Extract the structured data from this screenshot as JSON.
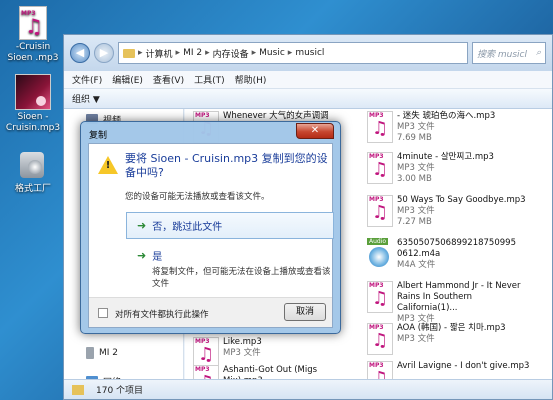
{
  "desktop": {
    "icons": [
      {
        "label": "-Cruisin Sioen .mp3",
        "icon": "mp3-file-icon",
        "badge": "MP3"
      },
      {
        "label": "Sioen - Cruisin.mp3",
        "icon": "album-art-icon"
      },
      {
        "label": "格式工厂",
        "icon": "format-factory-icon"
      }
    ]
  },
  "explorer": {
    "breadcrumb": [
      "计算机",
      "MI 2",
      "内存设备",
      "Music",
      "musicl"
    ],
    "search_placeholder": "搜索 musicl",
    "menu": [
      "文件(F)",
      "编辑(E)",
      "查看(V)",
      "工具(T)",
      "帮助(H)"
    ],
    "organize": "组织 ▼",
    "nav_items": [
      {
        "label": "视频",
        "icon": "video-folder-icon"
      },
      {
        "label": "MI 2",
        "icon": "phone-icon"
      },
      {
        "label": "网络",
        "icon": "network-icon"
      }
    ],
    "left_files": [
      {
        "name": "Whenever 大气的女声调调",
        "type": "",
        "size": ""
      },
      {
        "name": "Like.mp3",
        "type": "MP3 文件",
        "size": ""
      },
      {
        "name": "Ashanti-Got Out (Migs Mix).mp3",
        "type": "",
        "size": ""
      }
    ],
    "right_files": [
      {
        "name": "- 迷失 琥珀色の海へ.mp3",
        "type": "MP3 文件",
        "size": "7.69 MB",
        "kind": "mp3"
      },
      {
        "name": "4minute - 살만찌고.mp3",
        "type": "MP3 文件",
        "size": "3.00 MB",
        "kind": "mp3"
      },
      {
        "name": "50 Ways To Say Goodbye.mp3",
        "type": "MP3 文件",
        "size": "7.27 MB",
        "kind": "mp3"
      },
      {
        "name": "6350507506899218750995 0612.m4a",
        "type": "M4A 文件",
        "size": "",
        "kind": "m4a",
        "badge": "Audio"
      },
      {
        "name": "Albert Hammond Jr - It Never Rains In Southern California(1)...",
        "type": "MP3 文件",
        "size": "",
        "kind": "mp3"
      },
      {
        "name": "AOA (韩国) - 짧은 치마.mp3",
        "type": "MP3 文件",
        "size": "",
        "kind": "mp3"
      },
      {
        "name": "Avril Lavigne - I don't give.mp3",
        "type": "",
        "size": "",
        "kind": "mp3"
      }
    ],
    "status": "170 个项目"
  },
  "dialog": {
    "title": "复制",
    "close": "✕",
    "heading": "要将 Sioen - Cruisin.mp3 复制到您的设备中吗?",
    "sub": "您的设备可能无法播放或查看该文件。",
    "option1": "否，跳过此文件",
    "option2_title": "是",
    "option2_desc": "将复制文件，但可能无法在设备上播放或查看该文件",
    "checkbox_label": "对所有文件都执行此操作",
    "cancel": "取消",
    "option_arrow": "➜"
  },
  "colors": {
    "dialog_frame": "#a1c6e8",
    "link_blue": "#1a3d9a",
    "warning_yellow": "#f6c728",
    "mp3_pink": "#c0167e"
  }
}
